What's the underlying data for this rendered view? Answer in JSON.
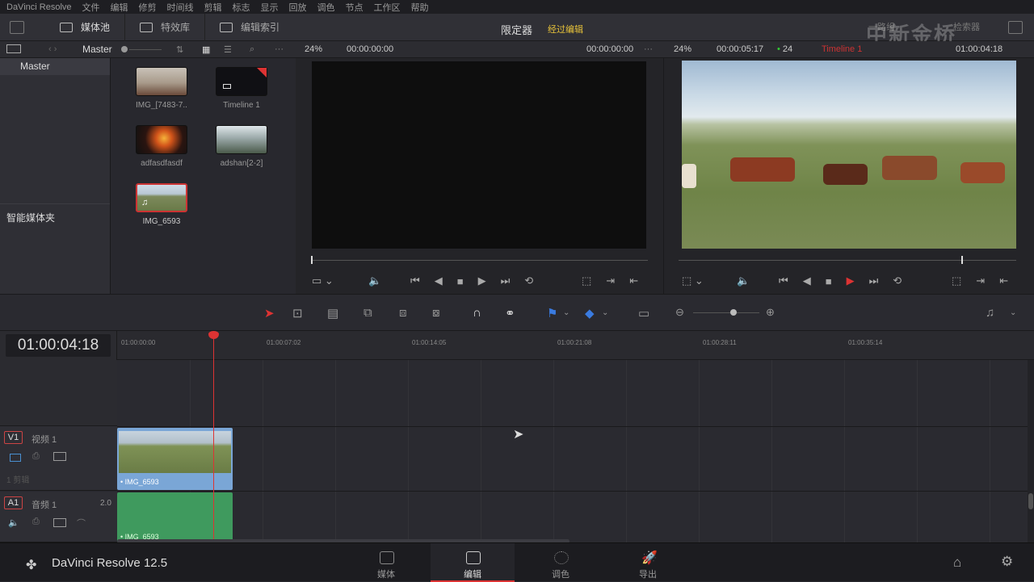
{
  "menubar": {
    "app": "DaVinci Resolve",
    "items": [
      "文件",
      "编辑",
      "修剪",
      "时间线",
      "剪辑",
      "标志",
      "显示",
      "回放",
      "调色",
      "节点",
      "工作区",
      "帮助"
    ]
  },
  "toolbar": {
    "media_pool": "媒体池",
    "effects": "特效库",
    "edit_index": "编辑索引",
    "limiter": "限定器",
    "mode": "经过编辑",
    "watermark": "中新金桥",
    "right_a": "一路组",
    "right_b": "检索器"
  },
  "subbar": {
    "bin": "Master",
    "zoom_src": "24%",
    "tc_src": "00:00:00:00",
    "tc_src_right": "00:00:00:00",
    "zoom_tl": "24%",
    "tc_tl": "00:00:05:17",
    "fps": "24",
    "timeline_name": "Timeline 1",
    "tc_tl_right": "01:00:04:18"
  },
  "leftpanel": {
    "master": "Master",
    "smart_bins": "智能媒体夹"
  },
  "clips": [
    {
      "label": "IMG_[7483-7..."
    },
    {
      "label": "Timeline 1"
    },
    {
      "label": "adfasdfasdf"
    },
    {
      "label": "adshan[2-2]"
    },
    {
      "label": "IMG_6593"
    }
  ],
  "timeline": {
    "timecode": "01:00:04:18",
    "ruler": [
      "01:00:00:00",
      "01:00:07:02",
      "01:00:14:05",
      "01:00:21:08",
      "01:00:28:11",
      "01:00:35:14"
    ],
    "v1": {
      "tag": "V1",
      "name": "视频 1",
      "sub": "1 剪辑",
      "clip": "• IMG_6593"
    },
    "a1": {
      "tag": "A1",
      "name": "音频 1",
      "level": "2.0",
      "clip": "• IMG_6593"
    }
  },
  "pages": [
    {
      "label": "媒体"
    },
    {
      "label": "编辑"
    },
    {
      "label": "调色"
    },
    {
      "label": "导出"
    }
  ],
  "brand": "DaVinci Resolve 12.5",
  "colors": {
    "accent": "#cc3333",
    "playhead": "#dd3333",
    "video_clip": "#7aa6d6",
    "audio_clip": "#3f9a5e",
    "mode_yellow": "#e8c33a"
  }
}
